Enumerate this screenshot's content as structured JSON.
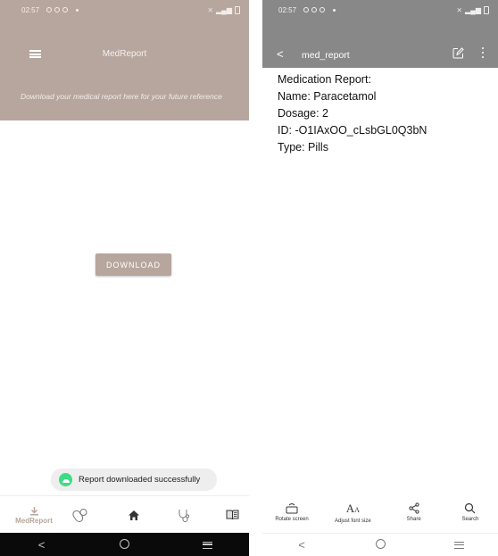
{
  "left": {
    "status_time": "02:57",
    "app_title": "MedReport",
    "tagline": "Download your medical report here for your future reference",
    "download_label": "DOWNLOAD",
    "toast_text": "Report downloaded successfully",
    "nav": {
      "active_label": "MedReport",
      "items": [
        "download-icon",
        "pills-icon",
        "home-icon",
        "stethoscope-icon",
        "book-icon"
      ]
    },
    "colors": {
      "accent": "#b6a69e",
      "toast_icon": "#3ddc84"
    }
  },
  "right": {
    "status_time": "02:57",
    "file_title": "med_report",
    "doc_lines": [
      "Medication Report:",
      "Name: Paracetamol",
      "Dosage: 2",
      "ID: -O1IAxOO_cLsbGL0Q3bN",
      "Type: Pills"
    ],
    "tools": {
      "rotate": "Rotate screen",
      "font": "Adjust font size",
      "share": "Share",
      "search": "Search"
    },
    "colors": {
      "toolbar": "#888888"
    }
  }
}
